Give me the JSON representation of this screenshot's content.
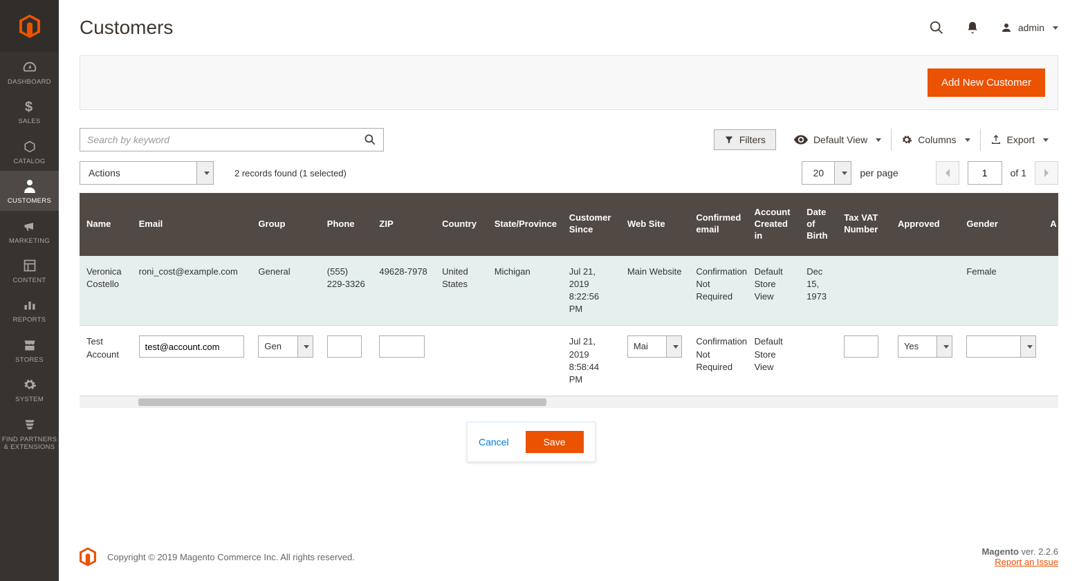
{
  "sidebar": {
    "items": [
      {
        "label": "DASHBOARD"
      },
      {
        "label": "SALES"
      },
      {
        "label": "CATALOG"
      },
      {
        "label": "CUSTOMERS"
      },
      {
        "label": "MARKETING"
      },
      {
        "label": "CONTENT"
      },
      {
        "label": "REPORTS"
      },
      {
        "label": "STORES"
      },
      {
        "label": "SYSTEM"
      },
      {
        "label": "FIND PARTNERS & EXTENSIONS"
      }
    ]
  },
  "page_title": "Customers",
  "user_label": "admin",
  "add_button": "Add New Customer",
  "search_placeholder": "Search by keyword",
  "filters_label": "Filters",
  "default_view_label": "Default View",
  "columns_label": "Columns",
  "export_label": "Export",
  "actions_label": "Actions",
  "records_found": "2 records found (1 selected)",
  "pager": {
    "page_size": "20",
    "per_page_label": "per page",
    "current": "1",
    "of_label": "of 1"
  },
  "columns_headers": [
    "Name",
    "Email",
    "Group",
    "Phone",
    "ZIP",
    "Country",
    "State/Province",
    "Customer Since",
    "Web Site",
    "Confirmed email",
    "Account Created in",
    "Date of Birth",
    "Tax VAT Number",
    "Approved",
    "Gender",
    "A"
  ],
  "rows": [
    {
      "name": "Veronica Costello",
      "email": "roni_cost@example.com",
      "group": "General",
      "phone": "(555) 229-3326",
      "zip": "49628-7978",
      "country": "United States",
      "state": "Michigan",
      "since": "Jul 21, 2019 8:22:56 PM",
      "website": "Main Website",
      "confirmed": "Confirmation Not Required",
      "created_in": "Default Store View",
      "dob": "Dec 15, 1973",
      "tax_vat": "",
      "approved": "",
      "gender": "Female"
    },
    {
      "name": "Test Account",
      "email": "test@account.com",
      "group": "Gen",
      "phone": "",
      "zip": "",
      "country": "",
      "state": "",
      "since": "Jul 21, 2019 8:58:44 PM",
      "website": "Mai",
      "confirmed": "Confirmation Not Required",
      "created_in": "Default Store View",
      "dob": "",
      "tax_vat": "",
      "approved": "Yes",
      "gender": ""
    }
  ],
  "inline": {
    "cancel": "Cancel",
    "save": "Save"
  },
  "footer": {
    "copyright": "Copyright © 2019 Magento Commerce Inc. All rights reserved.",
    "version_label": "Magento",
    "version": "ver. 2.2.6",
    "report": "Report an Issue"
  }
}
